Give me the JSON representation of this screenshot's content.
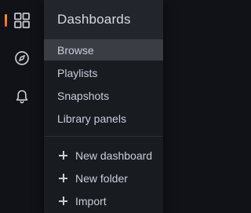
{
  "rail": {
    "items": [
      {
        "name": "dashboards",
        "icon": "apps-grid-icon",
        "active": true
      },
      {
        "name": "explore",
        "icon": "compass-icon",
        "active": false
      },
      {
        "name": "alerting",
        "icon": "bell-icon",
        "active": false
      }
    ],
    "accent_color": "#ff9830",
    "icon_color": "#c7c7cf"
  },
  "menu": {
    "title": "Dashboards",
    "items": [
      {
        "label": "Browse",
        "active": true
      },
      {
        "label": "Playlists",
        "active": false
      },
      {
        "label": "Snapshots",
        "active": false
      },
      {
        "label": "Library panels",
        "active": false
      }
    ],
    "actions": [
      {
        "label": "New dashboard",
        "icon": "plus-icon"
      },
      {
        "label": "New folder",
        "icon": "plus-icon"
      },
      {
        "label": "Import",
        "icon": "plus-icon"
      }
    ]
  }
}
